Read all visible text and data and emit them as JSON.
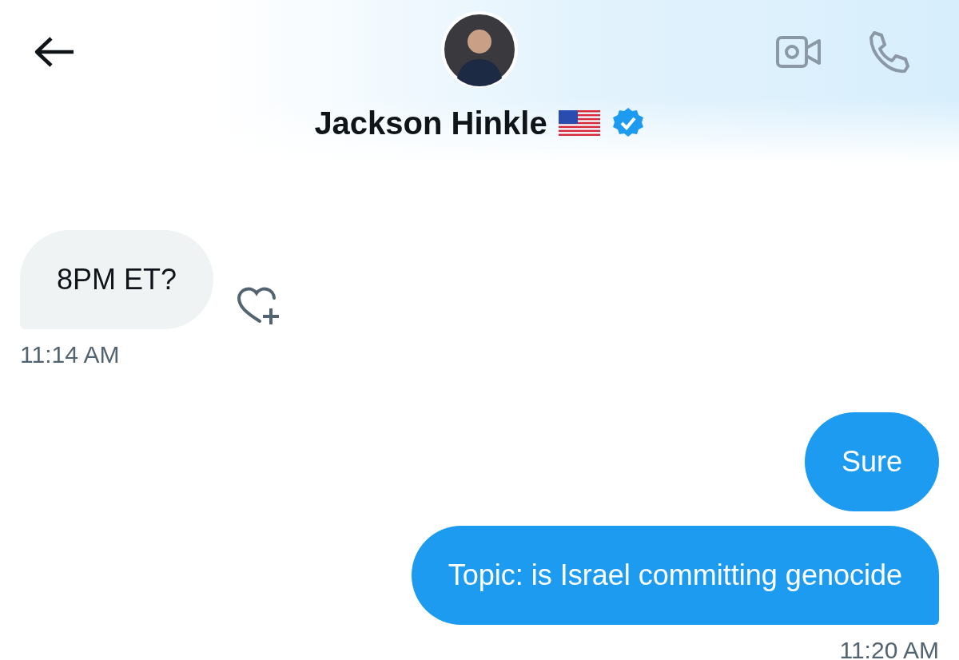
{
  "header": {
    "name": "Jackson Hinkle",
    "verified": true
  },
  "groups": [
    {
      "kind": "incoming",
      "messages": [
        "8PM ET?"
      ],
      "time": "11:14 AM"
    },
    {
      "kind": "outgoing",
      "messages": [
        "Sure",
        "Topic: is Israel committing genocide"
      ],
      "time": "11:20 AM"
    }
  ]
}
